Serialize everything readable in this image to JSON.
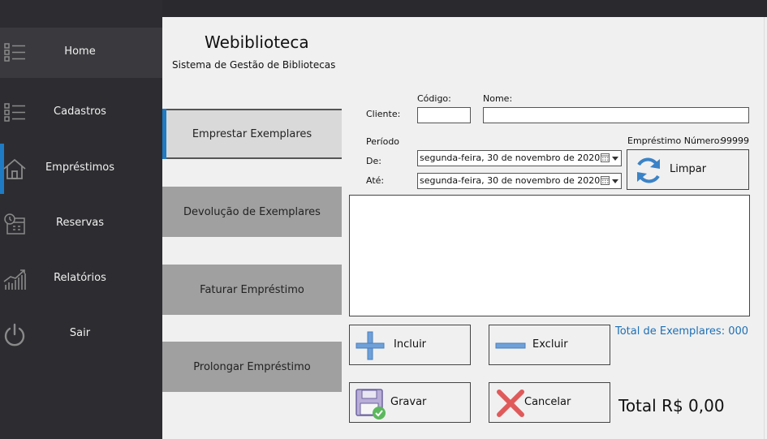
{
  "sidebar": {
    "items": [
      {
        "label": "Home",
        "icon": "list-icon"
      },
      {
        "label": "Cadastros",
        "icon": "list-icon"
      },
      {
        "label": "Empréstimos",
        "icon": "house-icon"
      },
      {
        "label": "Reservas",
        "icon": "calendar-clock-icon"
      },
      {
        "label": "Relatórios",
        "icon": "chart-icon"
      },
      {
        "label": "Sair",
        "icon": "power-icon"
      }
    ],
    "active_index": 2
  },
  "header": {
    "title": "Webiblioteca",
    "subtitle": "Sistema de Gestão de Bibliotecas"
  },
  "actions": {
    "items": [
      "Emprestar Exemplares",
      "Devolução de Exemplares",
      "Faturar Empréstimo",
      "Prolongar Empréstimo"
    ],
    "active_index": 0
  },
  "form": {
    "cliente_label": "Cliente:",
    "codigo_label": "Código:",
    "codigo_value": "",
    "nome_label": "Nome:",
    "nome_value": "",
    "periodo_label": "Período",
    "de_label": "De:",
    "ate_label": "Até:",
    "de_value": "segunda-feira, 30 de novembro de 2020",
    "ate_value": "segunda-feira, 30 de novembro de 2020",
    "emprestimo_label": "Empréstimo Número:",
    "emprestimo_numero": "99999"
  },
  "buttons": {
    "limpar": "Limpar",
    "incluir": "Incluir",
    "excluir": "Excluir",
    "gravar": "Gravar",
    "cancelar": "Cancelar"
  },
  "totals": {
    "exemplares": "Total de Exemplares: 000",
    "valor": "Total R$ 0,00"
  },
  "colors": {
    "sidebar_bg": "#2d2d31",
    "accent": "#1e7bc4",
    "main_bg": "#f0f0f0",
    "action_button_bg": "#a0a0a0",
    "link_text": "#1e6fb4"
  }
}
